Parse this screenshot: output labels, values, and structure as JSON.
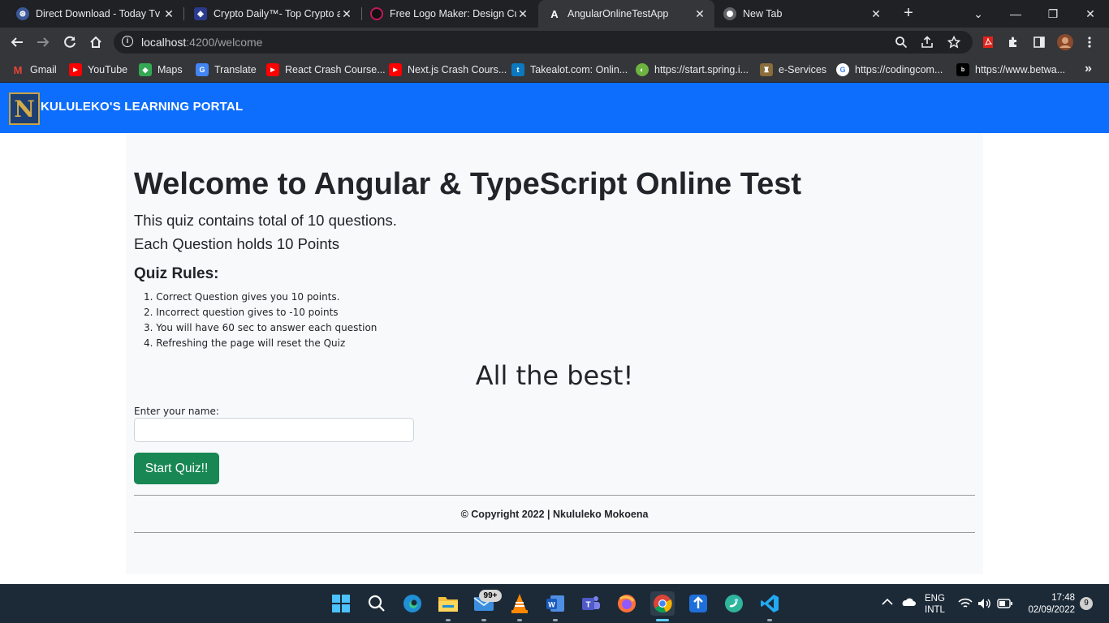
{
  "browser": {
    "tabs": [
      {
        "title": "Direct Download - Today Tv S",
        "icon": "steering-wheel-icon",
        "color": "#3b5998",
        "active": false
      },
      {
        "title": "Crypto Daily™- Top Crypto ar",
        "icon": "shield-icon",
        "color": "#2a3a8c",
        "active": false
      },
      {
        "title": "Free Logo Maker: Design Cus",
        "icon": "logo-maker-icon",
        "color": "#111111",
        "active": false
      },
      {
        "title": "AngularOnlineTestApp",
        "icon": "angular-icon",
        "color": "#ffffff",
        "active": true
      },
      {
        "title": "New Tab",
        "icon": "chrome-icon",
        "color": "#ffffff",
        "active": false
      }
    ],
    "close_glyph": "✕",
    "new_tab_glyph": "+",
    "window": {
      "chevron": "⌄",
      "minimize": "—",
      "restore": "❐",
      "close": "✕"
    },
    "url": {
      "host": "localhost",
      "rest": ":4200/welcome"
    },
    "info_glyph": "i",
    "bookmarks": [
      {
        "label": "Gmail",
        "icon": "gmail-icon",
        "color": "#ea4335",
        "glyph": "M"
      },
      {
        "label": "YouTube",
        "icon": "youtube-icon",
        "color": "#ff0000",
        "glyph": "▶"
      },
      {
        "label": "Maps",
        "icon": "maps-icon",
        "color": "#34a853",
        "glyph": "◆"
      },
      {
        "label": "Translate",
        "icon": "translate-icon",
        "color": "#4285f4",
        "glyph": "G"
      },
      {
        "label": "React Crash Course...",
        "icon": "youtube-icon",
        "color": "#ff0000",
        "glyph": "▶"
      },
      {
        "label": "Next.js Crash Cours...",
        "icon": "youtube-icon",
        "color": "#ff0000",
        "glyph": "▶"
      },
      {
        "label": "Takealot.com: Onlin...",
        "icon": "takealot-icon",
        "color": "#0b79bf",
        "glyph": "t"
      },
      {
        "label": "https://start.spring.i...",
        "icon": "spring-icon",
        "color": "#6db33f",
        "glyph": "◐"
      },
      {
        "label": "e-Services",
        "icon": "coat-of-arms-icon",
        "color": "#8a6d3b",
        "glyph": "♜"
      },
      {
        "label": "https://codingcom...",
        "icon": "google-icon",
        "color": "#ffffff",
        "glyph": "G"
      },
      {
        "label": "https://www.betwa...",
        "icon": "betway-icon",
        "color": "#000000",
        "glyph": "b"
      }
    ],
    "more_glyph": "»"
  },
  "page": {
    "brand_letter": "N",
    "brand": "KULULEKO'S LEARNING PORTAL",
    "title": "Welcome to Angular & TypeScript Online Test",
    "intro_1": "This quiz contains total of 10 questions.",
    "intro_2": "Each Question holds 10 Points",
    "rules_heading": "Quiz Rules:",
    "rules": [
      "1. Correct Question gives you 10 points.",
      "2. Incorrect question gives to -10 points",
      "3. You will have 60 sec to answer each question",
      "4. Refreshing the page will reset the Quiz"
    ],
    "wish": "All the best!",
    "name_label": "Enter your name:",
    "name_value": "",
    "start_button": "Start Quiz!!",
    "copyright": "© Copyright 2022 | Nkululeko Mokoena"
  },
  "taskbar": {
    "mail_badge": "99+",
    "lang_1": "ENG",
    "lang_2": "INTL",
    "time": "17:48",
    "date": "02/09/2022",
    "notifications": "9"
  },
  "colors": {
    "navbar": "#0d6efd",
    "start_button": "#198754",
    "container": "#f8f9fa"
  }
}
